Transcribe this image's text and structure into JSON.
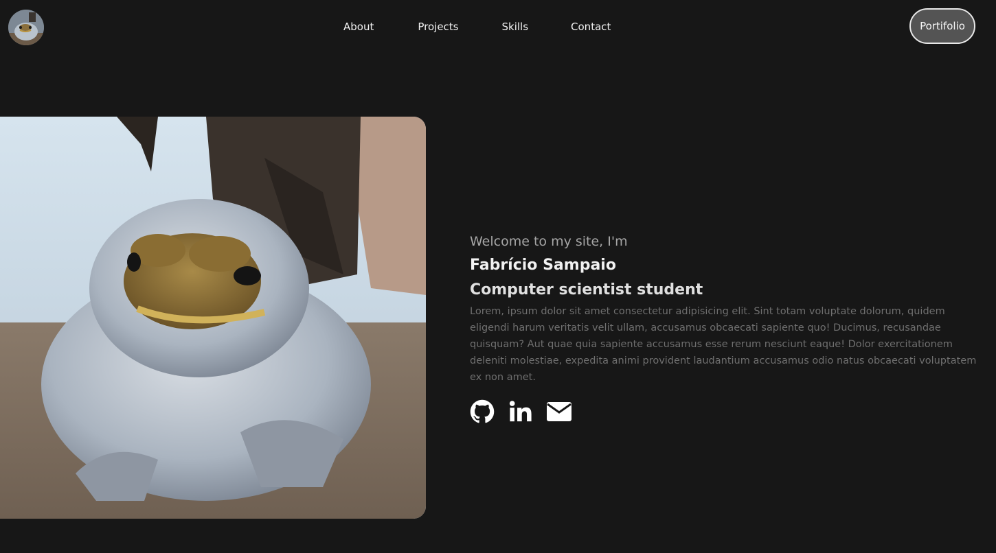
{
  "header": {
    "avatar_label": "avatar",
    "nav": [
      {
        "label": "About"
      },
      {
        "label": "Projects"
      },
      {
        "label": "Skills"
      },
      {
        "label": "Contact"
      }
    ],
    "cta_label": "Portifolio"
  },
  "hero": {
    "welcome": "Welcome to my site, I'm",
    "name": "Fabrício Sampaio",
    "role": "Computer scientist student",
    "bio": "Lorem, ipsum dolor sit amet consectetur adipisicing elit. Sint totam voluptate dolorum, quidem eligendi harum veritatis velit ullam, accusamus obcaecati sapiente quo! Ducimus, recusandae quisquam? Aut quae quia sapiente accusamus esse rerum nesciunt eaque! Dolor exercitationem deleniti molestiae, expedita animi provident laudantium accusamus odio natus obcaecati voluptatem ex non amet.",
    "socials": [
      {
        "icon": "github-icon"
      },
      {
        "icon": "linkedin-icon"
      },
      {
        "icon": "envelope-icon"
      }
    ]
  },
  "colors": {
    "background": "#171717",
    "text": "#f2f2f2",
    "muted": "#6f6f6f",
    "button_bg": "#545454"
  }
}
